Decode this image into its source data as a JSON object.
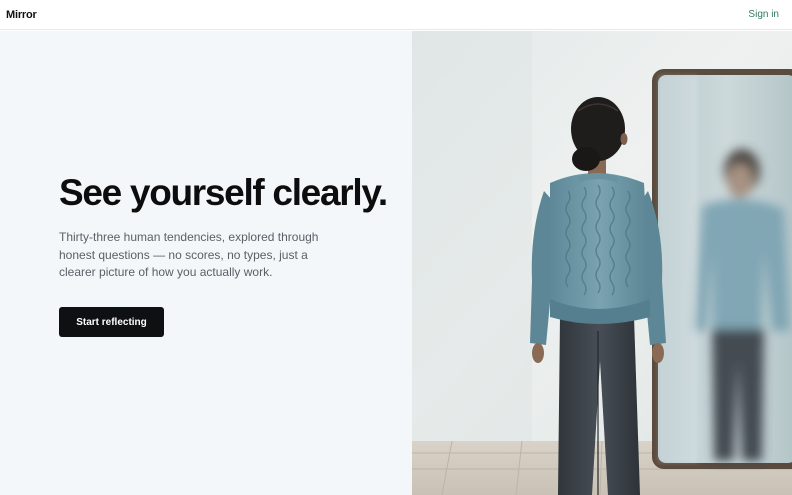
{
  "header": {
    "logo": "Mirror",
    "signin_label": "Sign in"
  },
  "hero": {
    "headline": "See yourself clearly.",
    "subtext": "Thirty-three human tendencies, explored through honest questions — no scores, no types, just a clearer picture of how you actually work.",
    "cta_label": "Start reflecting"
  },
  "illustration": {
    "subject": "person in blue cable-knit sweater facing a blurred mirror reflection"
  },
  "colors": {
    "accent": "#2f7a63",
    "cta_bg": "#0f1012",
    "left_bg": "#f4f7f9"
  }
}
